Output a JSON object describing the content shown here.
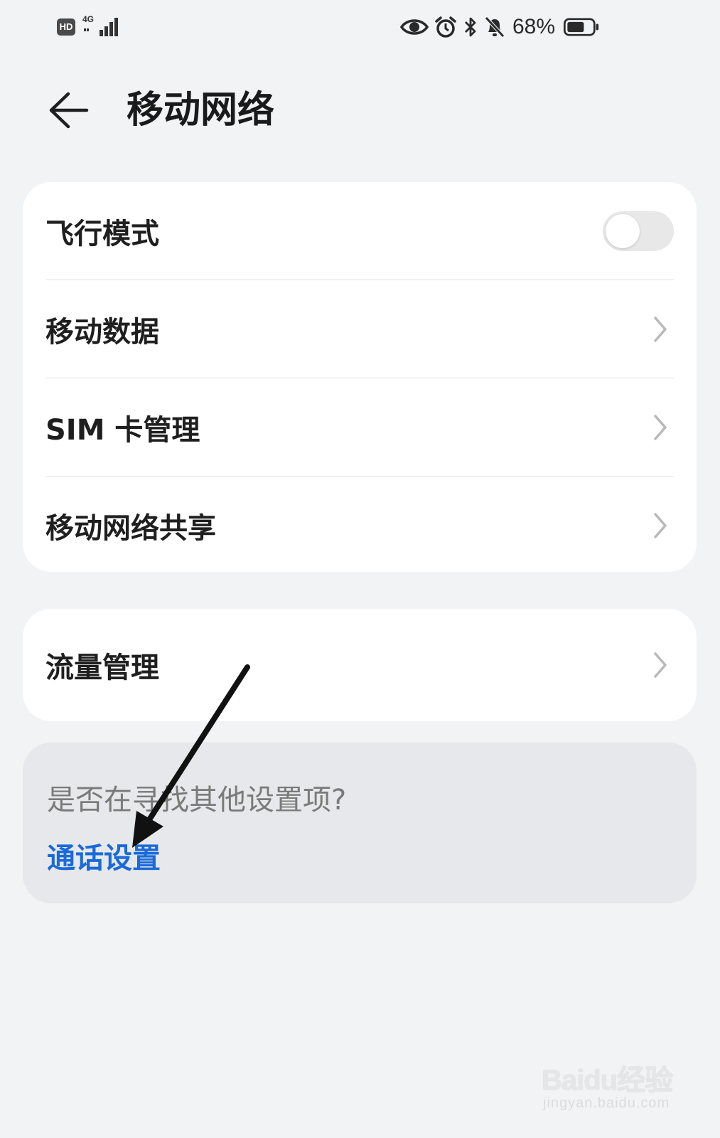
{
  "status_bar": {
    "hd_label": "HD",
    "network_type": "4G",
    "battery_percent": "68%",
    "battery_level": 0.68,
    "icons": [
      "hd-icon",
      "signal-icon",
      "eye-icon",
      "alarm-icon",
      "bluetooth-icon",
      "bell-off-icon",
      "battery-icon"
    ]
  },
  "header": {
    "title": "移动网络",
    "back_icon": "back-arrow-icon"
  },
  "settings_group_1": {
    "items": [
      {
        "label": "飞行模式",
        "control": "toggle",
        "toggle_on": false
      },
      {
        "label": "移动数据",
        "control": "chevron"
      },
      {
        "label": "SIM 卡管理",
        "control": "chevron"
      },
      {
        "label": "移动网络共享",
        "control": "chevron"
      }
    ]
  },
  "settings_group_2": {
    "items": [
      {
        "label": "流量管理",
        "control": "chevron"
      }
    ]
  },
  "suggestion": {
    "question": "是否在寻找其他设置项?",
    "link_label": "通话设置"
  },
  "watermark": {
    "brand": "Baidu经验",
    "url": "jingyan.baidu.com"
  },
  "colors": {
    "background": "#f1f3f5",
    "card": "#ffffff",
    "hint_card": "#e6e8eb",
    "link": "#1a6ad8",
    "toggle_off": "#e8e8e8"
  }
}
